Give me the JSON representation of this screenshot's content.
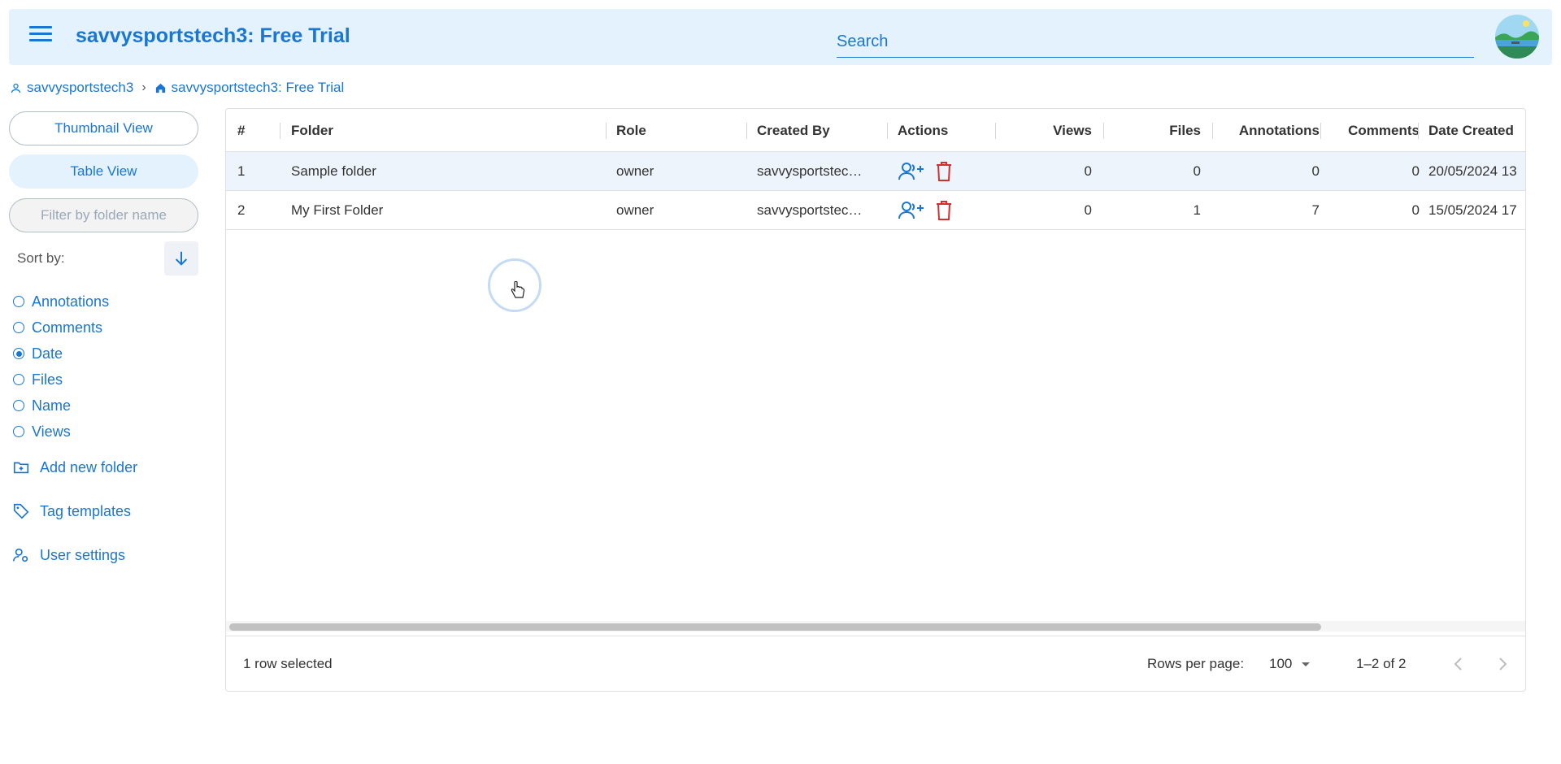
{
  "header": {
    "title": "savvysportstech3: Free Trial",
    "search_placeholder": "Search",
    "avatar_icon": "avatar-landscape-icon"
  },
  "breadcrumb": {
    "user": "savvysportstech3",
    "separator": "›",
    "workspace": "savvysportstech3: Free Trial"
  },
  "sidebar": {
    "thumbnail_view": "Thumbnail View",
    "table_view": "Table View",
    "filter_placeholder": "Filter by folder name",
    "sort_label": "Sort by:",
    "sort_options": [
      {
        "label": "Annotations",
        "selected": false
      },
      {
        "label": "Comments",
        "selected": false
      },
      {
        "label": "Date",
        "selected": true
      },
      {
        "label": "Files",
        "selected": false
      },
      {
        "label": "Name",
        "selected": false
      },
      {
        "label": "Views",
        "selected": false
      }
    ],
    "links": {
      "add_folder": "Add new folder",
      "tag_templates": "Tag templates",
      "user_settings": "User settings"
    }
  },
  "table": {
    "columns": {
      "index": "#",
      "folder": "Folder",
      "role": "Role",
      "created_by": "Created By",
      "actions": "Actions",
      "views": "Views",
      "files": "Files",
      "annotations": "Annotations",
      "comments": "Comments",
      "date_created": "Date Created"
    },
    "rows": [
      {
        "index": "1",
        "folder": "Sample folder",
        "role": "owner",
        "created_by": "savvysportstec…",
        "views": "0",
        "files": "0",
        "annotations": "0",
        "comments": "0",
        "date_created": "20/05/2024 13",
        "selected": true
      },
      {
        "index": "2",
        "folder": "My First Folder",
        "role": "owner",
        "created_by": "savvysportstec…",
        "views": "0",
        "files": "1",
        "annotations": "7",
        "comments": "0",
        "date_created": "15/05/2024 17",
        "selected": false
      }
    ],
    "footer": {
      "selected_text": "1 row selected",
      "rows_per_page_label": "Rows per page:",
      "rows_per_page_value": "100",
      "range_text": "1–2 of 2"
    }
  },
  "colors": {
    "accent": "#1976d2",
    "header_bg": "#e3f2fd",
    "delete": "#d32f2f"
  }
}
